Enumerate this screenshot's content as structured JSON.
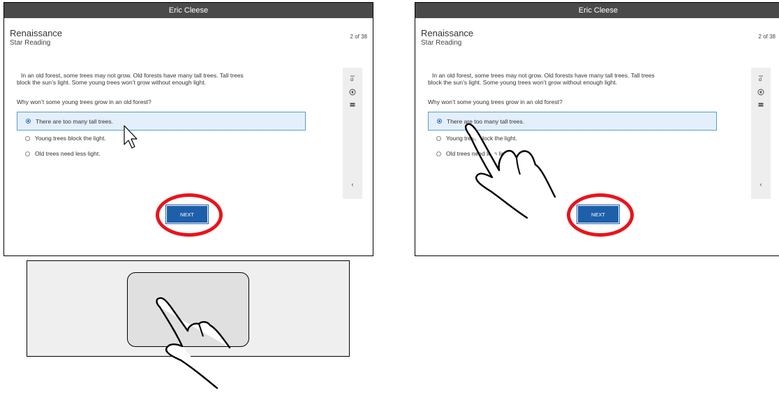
{
  "app": {
    "titlebar_user": "Eric Cleese",
    "brand": "Renaissance",
    "product": "Star Reading",
    "page_indicator": "2 of 38"
  },
  "passage": "In an old forest, some trees may not grow. Old forests have many tall trees. Tall trees block the sun’s light. Some young trees won’t grow without enough light.",
  "question": "Why won’t some young trees grow in an old forest?",
  "options": [
    {
      "label": "There are too many tall trees.",
      "selected": true
    },
    {
      "label": "Young trees block the light.",
      "selected": false
    },
    {
      "label": "Old trees need less light.",
      "selected": false
    }
  ],
  "tools": {
    "translate_icon": "translate-icon",
    "audio_icon": "speaker-icon",
    "menu_icon": "equals-icon",
    "collapse_label": "‹"
  },
  "next_button": {
    "label": "NEXT"
  },
  "colors": {
    "titlebar": "#4a4a4a",
    "accent": "#1d5fa8",
    "selection_fill": "#e3f0fb",
    "selection_border": "#5b9bd5",
    "highlight": "#e8141c"
  }
}
